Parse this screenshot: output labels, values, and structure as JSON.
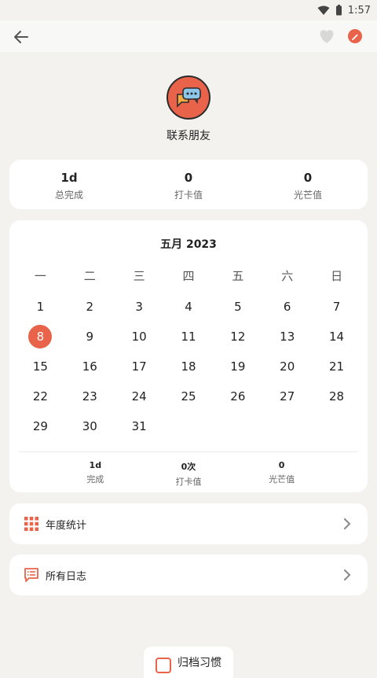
{
  "status_bar": {
    "time": "1:57"
  },
  "header": {
    "habit_name": "联系朋友"
  },
  "summary": [
    {
      "value": "1d",
      "label": "总完成"
    },
    {
      "value": "0",
      "label": "打卡值"
    },
    {
      "value": "0",
      "label": "光芒值"
    }
  ],
  "calendar": {
    "title": "五月 2023",
    "weekdays": [
      "一",
      "二",
      "三",
      "四",
      "五",
      "六",
      "日"
    ],
    "days": [
      "1",
      "2",
      "3",
      "4",
      "5",
      "6",
      "7",
      "8",
      "9",
      "10",
      "11",
      "12",
      "13",
      "14",
      "15",
      "16",
      "17",
      "18",
      "19",
      "20",
      "21",
      "22",
      "23",
      "24",
      "25",
      "26",
      "27",
      "28",
      "29",
      "30",
      "31"
    ],
    "selected_day": "8",
    "month_stats": [
      {
        "value": "1d",
        "label": "完成"
      },
      {
        "value": "0次",
        "label": "打卡值"
      },
      {
        "value": "0",
        "label": "光芒值"
      }
    ]
  },
  "menu": {
    "annual_label": "年度统计",
    "logs_label": "所有日志"
  },
  "archive_button": {
    "label": "归档习惯"
  },
  "colors": {
    "accent": "#e9634a",
    "background": "#f3f2ee",
    "card": "#ffffff"
  },
  "icons": {
    "back": "arrow-left-icon",
    "favorite": "heart-icon",
    "edit": "pencil-icon",
    "habit": "chat-bubbles-icon",
    "annual": "grid-icon",
    "logs": "list-icon",
    "chevron": "chevron-right-icon",
    "archive": "archive-icon"
  }
}
